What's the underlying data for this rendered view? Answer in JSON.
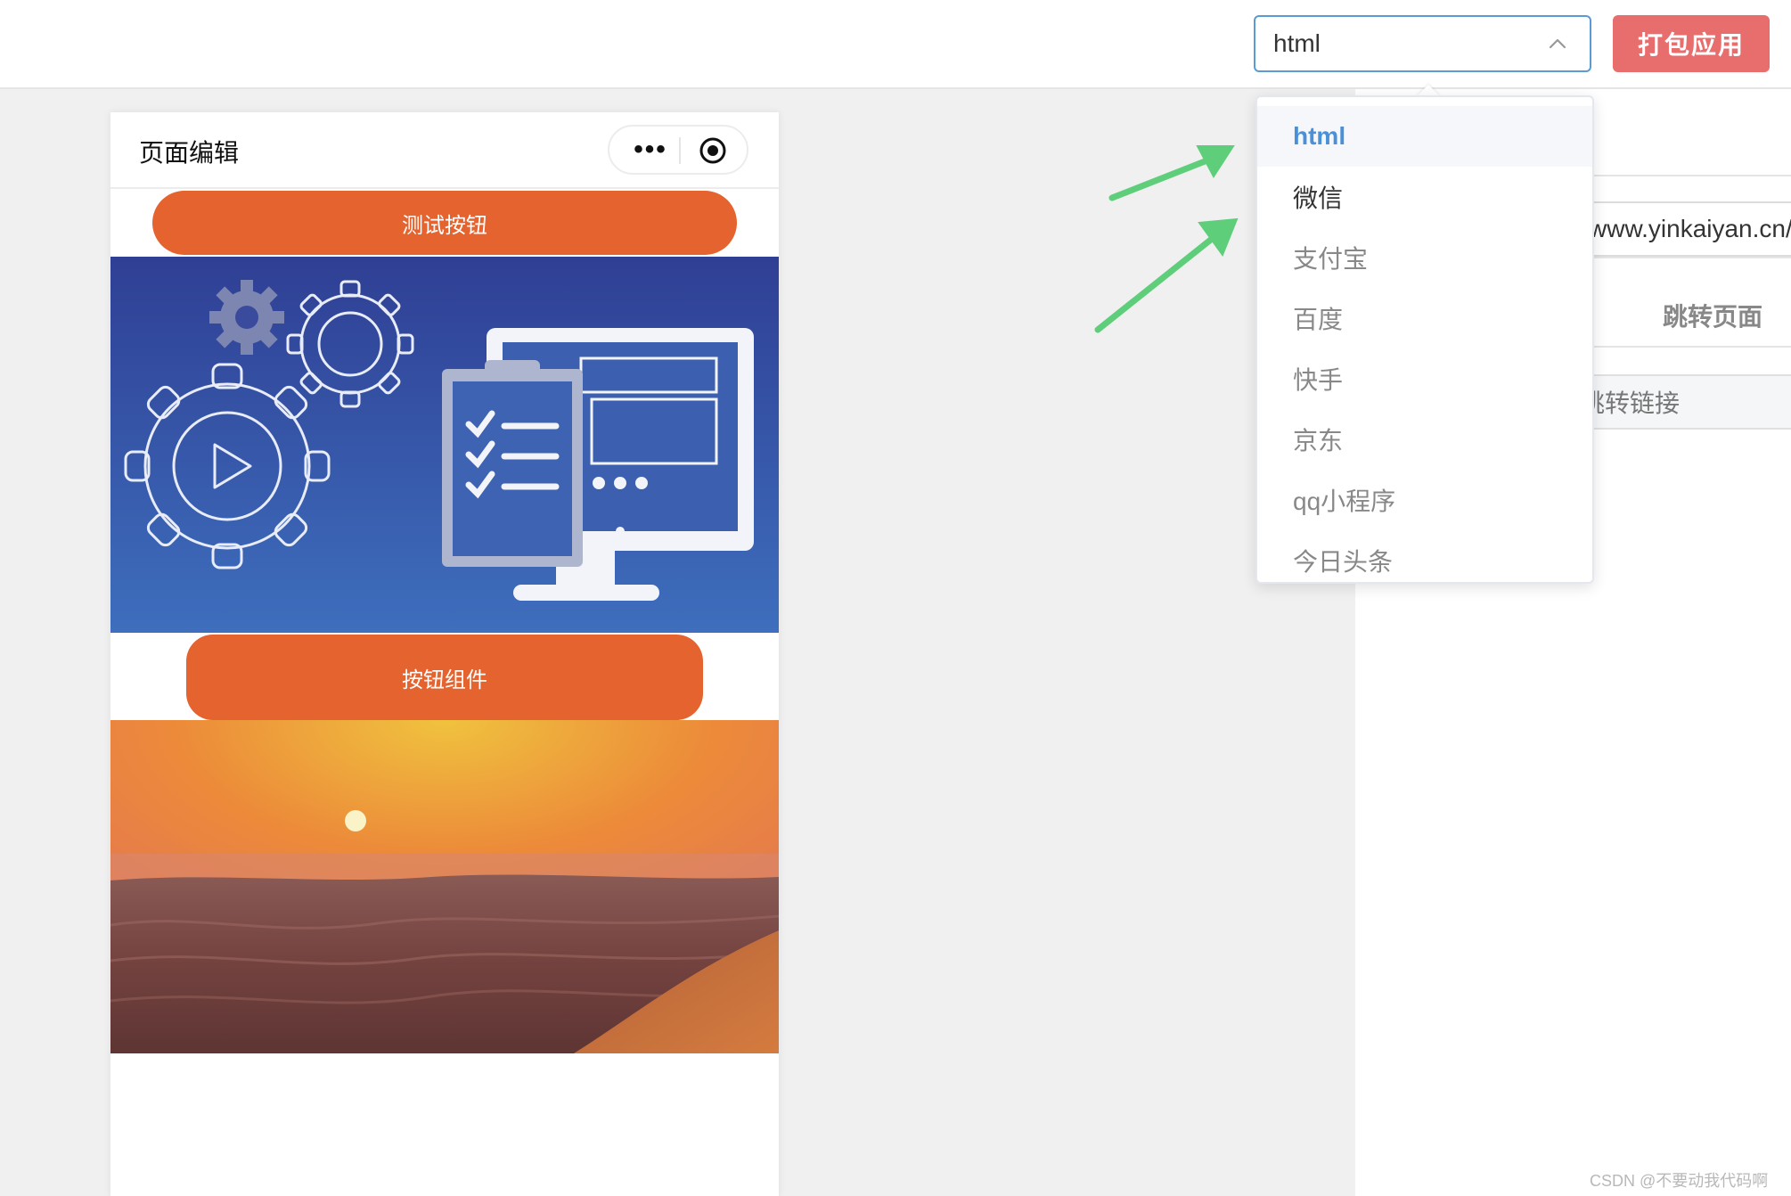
{
  "topbar": {
    "platform_select": {
      "value": "html"
    },
    "build_button": "打包应用"
  },
  "phone": {
    "title": "页面编辑",
    "capsule_more": "•••",
    "test_button": "测试按钮",
    "component_button": "按钮组件"
  },
  "dropdown": {
    "options": [
      "html",
      "微信",
      "支付宝",
      "百度",
      "快手",
      "京东",
      "qq小程序",
      "今日头条"
    ],
    "selected_index": 0
  },
  "panel": {
    "url_value": "www.yinkaiyan.cn/",
    "jump_page_label": "跳转页面",
    "jump_link_label": "跳转链接"
  },
  "watermark": "CSDN @不要动我代码啊",
  "colors": {
    "accent_blue": "#4a90d9",
    "build_button": "#e86e6e",
    "orange_button": "#e4632e",
    "arrow_green": "#5fce7a"
  },
  "icons": [
    "chevron-up-icon",
    "more-dots-icon",
    "target-circle-icon",
    "gear-icon",
    "play-icon",
    "monitor-icon",
    "clipboard-checklist-icon",
    "arrow-icon"
  ]
}
